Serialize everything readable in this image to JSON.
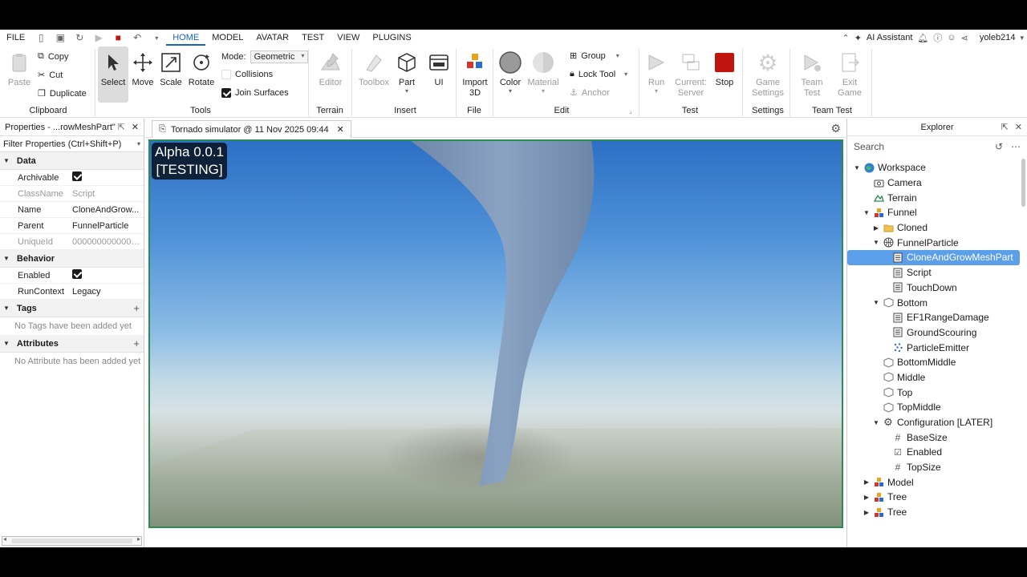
{
  "menu": {
    "items": [
      "FILE",
      "HOME",
      "MODEL",
      "AVATAR",
      "TEST",
      "VIEW",
      "PLUGINS"
    ],
    "active": "HOME",
    "ai_assistant": "AI Assistant",
    "user": "yoleb214"
  },
  "ribbon": {
    "clipboard": {
      "paste": "Paste",
      "copy": "Copy",
      "cut": "Cut",
      "duplicate": "Duplicate",
      "group": "Clipboard"
    },
    "tools": {
      "select": "Select",
      "move": "Move",
      "scale": "Scale",
      "rotate": "Rotate",
      "mode_label": "Mode:",
      "mode_value": "Geometric",
      "collisions": "Collisions",
      "join_surfaces": "Join Surfaces",
      "group": "Tools"
    },
    "terrain": {
      "editor": "Editor",
      "group": "Terrain"
    },
    "insert": {
      "toolbox": "Toolbox",
      "part": "Part",
      "ui": "UI",
      "group": "Insert"
    },
    "file": {
      "import3d": "Import 3D",
      "group": "File"
    },
    "edit": {
      "color": "Color",
      "material": "Material",
      "group_btn": "Group",
      "lock_tool": "Lock Tool",
      "anchor": "Anchor",
      "group": "Edit"
    },
    "test": {
      "run": "Run",
      "current_server": "Current: Server",
      "stop": "Stop",
      "group": "Test"
    },
    "settings": {
      "game_settings": "Game Settings",
      "group": "Settings"
    },
    "team_test": {
      "team_test": "Team Test",
      "exit_game": "Exit Game",
      "group": "Team Test"
    }
  },
  "properties": {
    "title": "Properties - ...rowMeshPart\"",
    "filter": "Filter Properties (Ctrl+Shift+P)",
    "sections": {
      "data": "Data",
      "behavior": "Behavior",
      "tags": "Tags",
      "attributes": "Attributes"
    },
    "rows": {
      "archivable": "Archivable",
      "classname": "ClassName",
      "classname_v": "Script",
      "name": "Name",
      "name_v": "CloneAndGrow...",
      "parent": "Parent",
      "parent_v": "FunnelParticle",
      "uniqueid": "UniqueId",
      "uniqueid_v": "0000000000000...",
      "enabled": "Enabled",
      "runcontext": "RunContext",
      "runcontext_v": "Legacy"
    },
    "tags_empty": "No Tags have been added yet",
    "attributes_empty": "No Attribute has been added yet"
  },
  "viewport": {
    "tab_title": "Tornado simulator @ 11 Nov 2025 09:44",
    "overlay_line1": "Alpha 0.0.1",
    "overlay_line2": "[TESTING]"
  },
  "explorer": {
    "title": "Explorer",
    "search_placeholder": "Search",
    "nodes": [
      "Workspace",
      "Camera",
      "Terrain",
      "Funnel",
      "Cloned",
      "FunnelParticle",
      "CloneAndGrowMeshPart",
      "Script",
      "TouchDown",
      "Bottom",
      "EF1RangeDamage",
      "GroundScouring",
      "ParticleEmitter",
      "BottomMiddle",
      "Middle",
      "Top",
      "TopMiddle",
      "Configuration [LATER]",
      "BaseSize",
      "Enabled",
      "TopSize",
      "Model",
      "Tree",
      "Tree"
    ]
  },
  "colors": {
    "accent": "#1565c0",
    "selection": "#5b9ee9",
    "viewport_border": "#2e8b57",
    "stop": "#c0150f"
  }
}
